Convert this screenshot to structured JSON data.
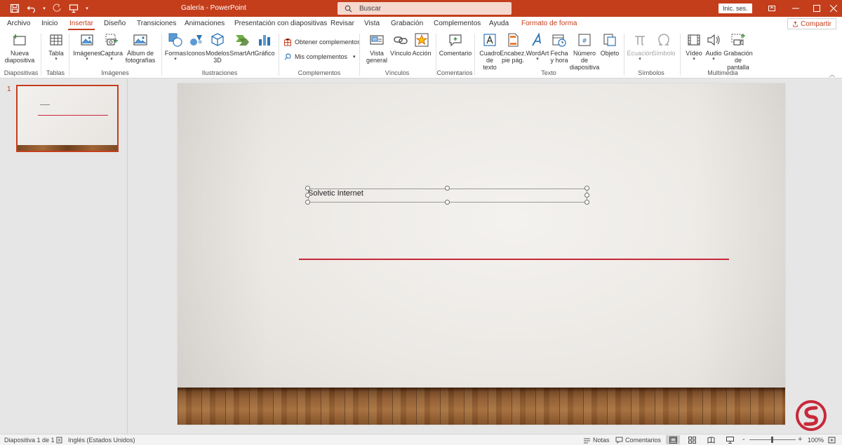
{
  "window": {
    "title": "Galería  -  PowerPoint",
    "search_placeholder": "Buscar",
    "signin": "Inic. ses.",
    "share": "Compartir"
  },
  "menu": {
    "tabs": [
      {
        "label": "Archivo"
      },
      {
        "label": "Inicio"
      },
      {
        "label": "Insertar"
      },
      {
        "label": "Diseño"
      },
      {
        "label": "Transiciones"
      },
      {
        "label": "Animaciones"
      },
      {
        "label": "Presentación con diapositivas"
      },
      {
        "label": "Revisar"
      },
      {
        "label": "Vista"
      },
      {
        "label": "Grabación"
      },
      {
        "label": "Complementos"
      },
      {
        "label": "Ayuda"
      },
      {
        "label": "Formato de forma"
      }
    ],
    "active": "Insertar"
  },
  "ribbon": {
    "groups": {
      "diapositivas": "Diapositivas",
      "tablas": "Tablas",
      "imagenes": "Imágenes",
      "ilustraciones": "Ilustraciones",
      "complementos": "Complementos",
      "vinculos": "Vínculos",
      "comentarios": "Comentarios",
      "texto": "Texto",
      "simbolos": "Símbolos",
      "multimedia": "Multimedia"
    },
    "buttons": {
      "nueva_l1": "Nueva",
      "nueva_l2": "diapositiva",
      "tabla": "Tabla",
      "imagenes": "Imágenes",
      "captura": "Captura",
      "album_l1": "Álbum de",
      "album_l2": "fotografías",
      "formas": "Formas",
      "iconos": "Iconos",
      "modelos_l1": "Modelos",
      "modelos_l2": "3D",
      "smartart": "SmartArt",
      "grafico": "Gráfico",
      "obtener": "Obtener complementos",
      "mis": "Mis complementos",
      "vista_l1": "Vista",
      "vista_l2": "general",
      "vinculo": "Vínculo",
      "accion": "Acción",
      "comentario": "Comentario",
      "cuadro_l1": "Cuadro",
      "cuadro_l2": "de texto",
      "encabez_l1": "Encabez.",
      "encabez_l2": "pie pág.",
      "wordart": "WordArt",
      "fecha_l1": "Fecha",
      "fecha_l2": "y hora",
      "numero_l1": "Número de",
      "numero_l2": "diapositiva",
      "objeto": "Objeto",
      "ecuacion": "Ecuación",
      "simbolo": "Símbolo",
      "video": "Vídeo",
      "audio": "Audio",
      "grabacion_l1": "Grabación",
      "grabacion_l2": "de pantalla"
    }
  },
  "thumbnails": {
    "number": "1"
  },
  "slide": {
    "textbox": "Solvetic Internet"
  },
  "status": {
    "slide_info": "Diapositiva 1 de 1",
    "language": "Inglés (Estados Unidos)",
    "notes": "Notas",
    "comments": "Comentarios",
    "zoom_minus": "-",
    "zoom_plus": "+",
    "zoom": "100%"
  },
  "colors": {
    "accent": "#c43e1c",
    "line": "#c8283a"
  }
}
